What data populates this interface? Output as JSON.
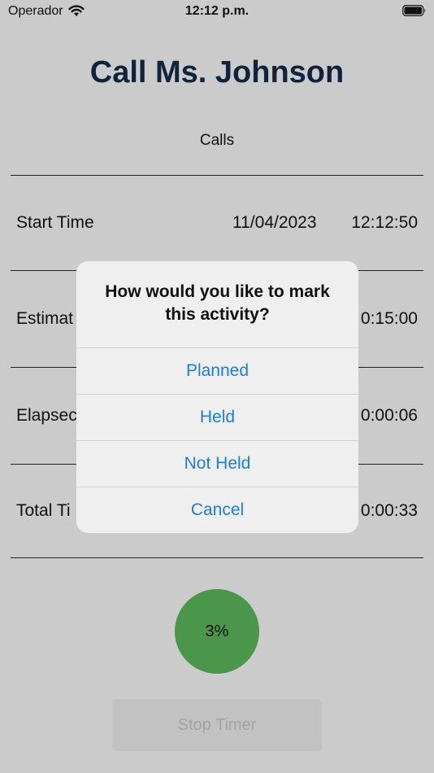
{
  "status_bar": {
    "carrier": "Operador",
    "time": "12:12 p.m."
  },
  "header": {
    "title": "Call Ms. Johnson",
    "subtitle": "Calls"
  },
  "rows": [
    {
      "label": "Start Time",
      "date": "11/04/2023",
      "time": "12:12:50"
    },
    {
      "label": "Estimat",
      "time": "0:15:00"
    },
    {
      "label": "Elapsec",
      "time": "0:00:06"
    },
    {
      "label": "Total Ti",
      "time": "0:00:33"
    }
  ],
  "progress": {
    "label": "3%",
    "value": 0.03
  },
  "stop_button": {
    "label": "Stop Timer"
  },
  "alert": {
    "title_line1": "How would you like to mark",
    "title_line2": "this activity?",
    "buttons": [
      "Planned",
      "Held",
      "Not Held",
      "Cancel"
    ]
  },
  "colors": {
    "accent": "#1a7ee0",
    "title": "#10233d",
    "progress": "#4a964b",
    "background": "#cbcbcb"
  }
}
